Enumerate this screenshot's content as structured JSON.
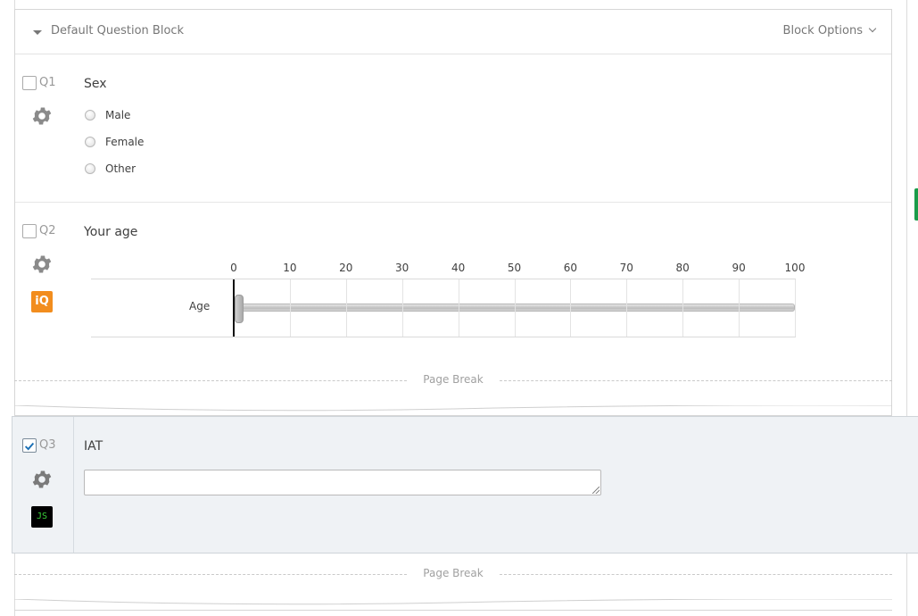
{
  "block": {
    "title": "Default Question Block",
    "options_label": "Block Options"
  },
  "questions": [
    {
      "number": "Q1",
      "title": "Sex",
      "checked": false,
      "choices": [
        "Male",
        "Female",
        "Other"
      ]
    },
    {
      "number": "Q2",
      "title": "Your age",
      "checked": false,
      "icon": "iQ",
      "slider": {
        "ticks": [
          "0",
          "10",
          "20",
          "30",
          "40",
          "50",
          "60",
          "70",
          "80",
          "90",
          "100"
        ],
        "statement": "Age",
        "min": 0,
        "max": 100,
        "value": 0
      }
    },
    {
      "number": "Q3",
      "title": "IAT",
      "checked": true,
      "icon": "JS",
      "text_value": ""
    }
  ],
  "page_break_label": "Page Break",
  "colors": {
    "iq_badge": "#f28d1e",
    "js_badge_bg": "#000000",
    "js_badge_text": "#39d039",
    "selected_panel": "#eff2f5",
    "side_tab": "#1a9c4a"
  },
  "icons": [
    "caret-down-icon",
    "chevron-down-icon",
    "gear-icon",
    "iq-icon",
    "js-icon",
    "checkmark-icon"
  ]
}
